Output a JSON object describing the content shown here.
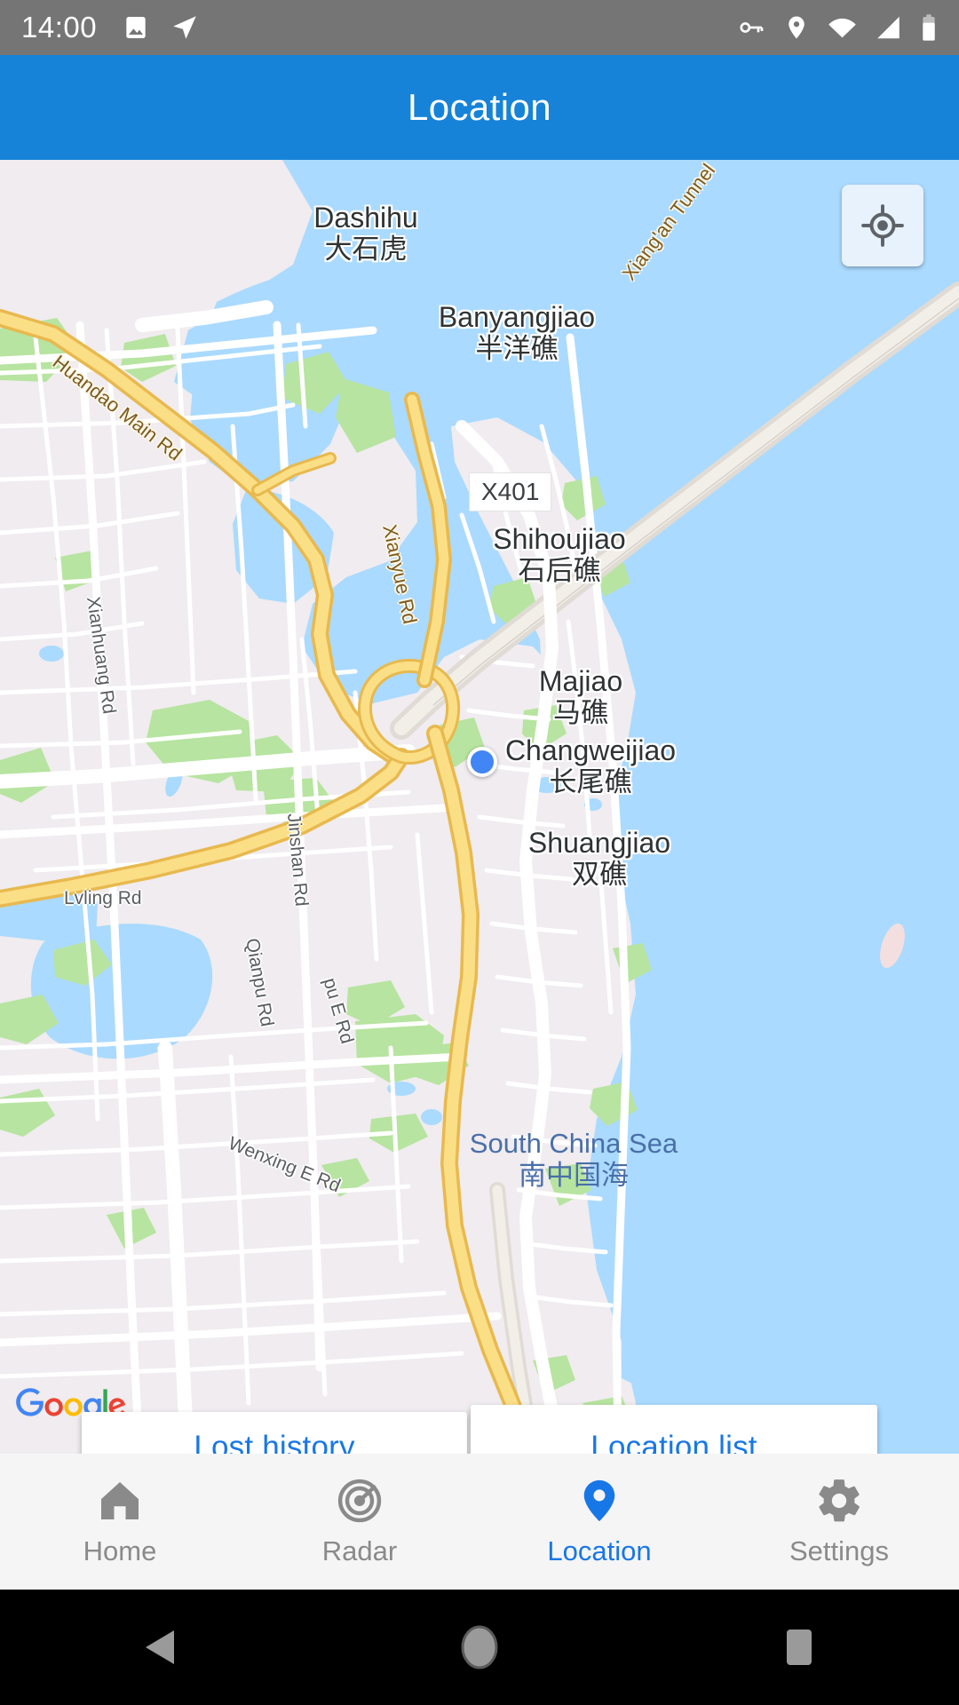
{
  "status_bar": {
    "time": "14:00",
    "left_icons": [
      "image-icon",
      "navigation-send-icon"
    ],
    "right_icons": [
      "vpn-key-icon",
      "location-pin-icon",
      "wifi-off-icon",
      "cell-signal-icon",
      "battery-icon"
    ],
    "background": "#757575"
  },
  "app_bar": {
    "title": "Location",
    "background": "#1683d8",
    "text_color": "#ffffff"
  },
  "map": {
    "provider_logo": "Google",
    "my_location_button": "my-location-crosshair-icon",
    "user_marker": "blue-dot-current-location",
    "accent_blue": "#4285f4",
    "water_color": "#aadaff",
    "land_color": "#f0ecef",
    "park_color": "#b7e4a0",
    "highway_color": "#f9d675",
    "places": [
      {
        "en": "Dashihu",
        "zh": "大石虎"
      },
      {
        "en": "Banyangjiao",
        "zh": "半洋礁"
      },
      {
        "en": "Shihoujiao",
        "zh": "石后礁"
      },
      {
        "en": "Majiao",
        "zh": "马礁"
      },
      {
        "en": "Changweijiao",
        "zh": "长尾礁"
      },
      {
        "en": "Shuangjiao",
        "zh": "双礁"
      }
    ],
    "sea": {
      "en": "South China Sea",
      "zh": "南中国海"
    },
    "highway_shield": "X401",
    "highway_labels": [
      "Huandao Main Rd",
      "Xianyue Rd",
      "Xiang'an Tunnel"
    ],
    "road_labels": [
      "Xianhuang Rd",
      "Jinshan Rd",
      "Lvling Rd",
      "Qianpu Rd",
      "pu E Rd",
      "Wenxing E Rd"
    ]
  },
  "map_buttons": {
    "lost_history": "Lost history",
    "location_list": "Location list",
    "text_color": "#1877e6"
  },
  "tab_bar": {
    "active_color": "#1877e6",
    "inactive_color": "#8a8a8a",
    "items": [
      {
        "label": "Home",
        "icon": "home-icon",
        "active": false
      },
      {
        "label": "Radar",
        "icon": "radar-icon",
        "active": false
      },
      {
        "label": "Location",
        "icon": "location-pin-icon",
        "active": true
      },
      {
        "label": "Settings",
        "icon": "gear-icon",
        "active": false
      }
    ]
  },
  "nav_bar": {
    "buttons": [
      "back-triangle-icon",
      "home-circle-icon",
      "recents-square-icon"
    ]
  }
}
